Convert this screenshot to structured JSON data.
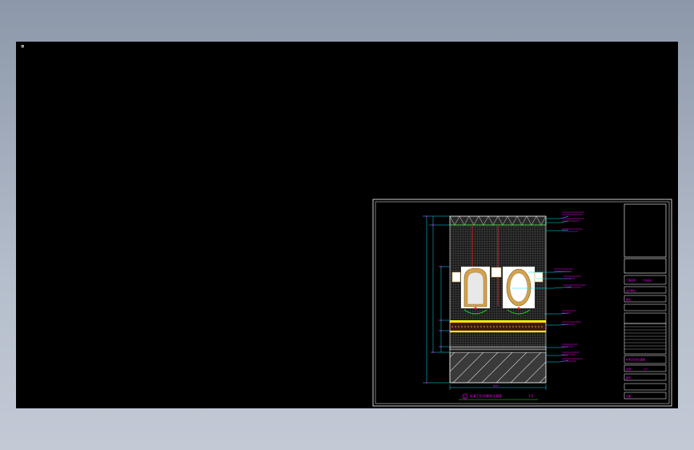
{
  "viewport": {
    "background": "#000000",
    "ucs_icon": "⊕"
  },
  "drawing": {
    "title": "标准卫生间装饰立面图",
    "scale": "1:5",
    "title_index": "2",
    "dimension_bottom": "900",
    "colors": {
      "magenta": "#ff00ff",
      "cyan": "#00e0ff",
      "yellow": "#ffff00",
      "white": "#ffffff",
      "red": "#ff2020",
      "green": "#00ff00",
      "frame_gold": "#d4a24a"
    }
  },
  "title_block": {
    "labels": [
      "工程名称",
      "广州某某",
      "设计单位",
      "图名",
      "标准卫生间立面图",
      "比例",
      "1:5",
      "图号",
      "日期"
    ]
  }
}
